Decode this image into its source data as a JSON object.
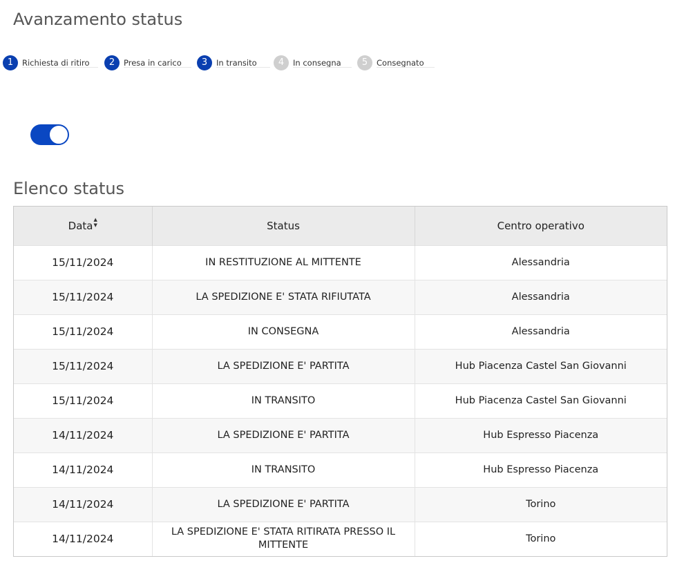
{
  "progress": {
    "title": "Avanzamento status",
    "steps": [
      {
        "number": "1",
        "label": "Richiesta di ritiro",
        "state": "done"
      },
      {
        "number": "2",
        "label": "Presa in carico",
        "state": "done"
      },
      {
        "number": "3",
        "label": "In transito",
        "state": "done"
      },
      {
        "number": "4",
        "label": "In consegna",
        "state": "todo"
      },
      {
        "number": "5",
        "label": "Consegnato",
        "state": "todo"
      }
    ]
  },
  "toggle": {
    "state": "on"
  },
  "status_list": {
    "title": "Elenco status",
    "columns": [
      "Data",
      "Status",
      "Centro operativo"
    ],
    "sort_icon": "sort-icon",
    "rows": [
      {
        "date": "15/11/2024",
        "status": "IN RESTITUZIONE AL MITTENTE",
        "center": "Alessandria"
      },
      {
        "date": "15/11/2024",
        "status": "LA SPEDIZIONE E' STATA RIFIUTATA",
        "center": "Alessandria"
      },
      {
        "date": "15/11/2024",
        "status": "IN CONSEGNA",
        "center": "Alessandria"
      },
      {
        "date": "15/11/2024",
        "status": "LA SPEDIZIONE E' PARTITA",
        "center": "Hub Piacenza Castel San Giovanni"
      },
      {
        "date": "15/11/2024",
        "status": "IN TRANSITO",
        "center": "Hub Piacenza Castel San Giovanni"
      },
      {
        "date": "14/11/2024",
        "status": "LA SPEDIZIONE E' PARTITA",
        "center": "Hub Espresso Piacenza"
      },
      {
        "date": "14/11/2024",
        "status": "IN TRANSITO",
        "center": "Hub Espresso Piacenza"
      },
      {
        "date": "14/11/2024",
        "status": "LA SPEDIZIONE E' PARTITA",
        "center": "Torino"
      },
      {
        "date": "14/11/2024",
        "status": "LA SPEDIZIONE E' STATA RITIRATA PRESSO IL MITTENTE",
        "center": "Torino"
      }
    ]
  },
  "colors": {
    "primary": "#0a3fb0",
    "inactive": "#cfcfcf",
    "header_bg": "#ebebeb"
  }
}
